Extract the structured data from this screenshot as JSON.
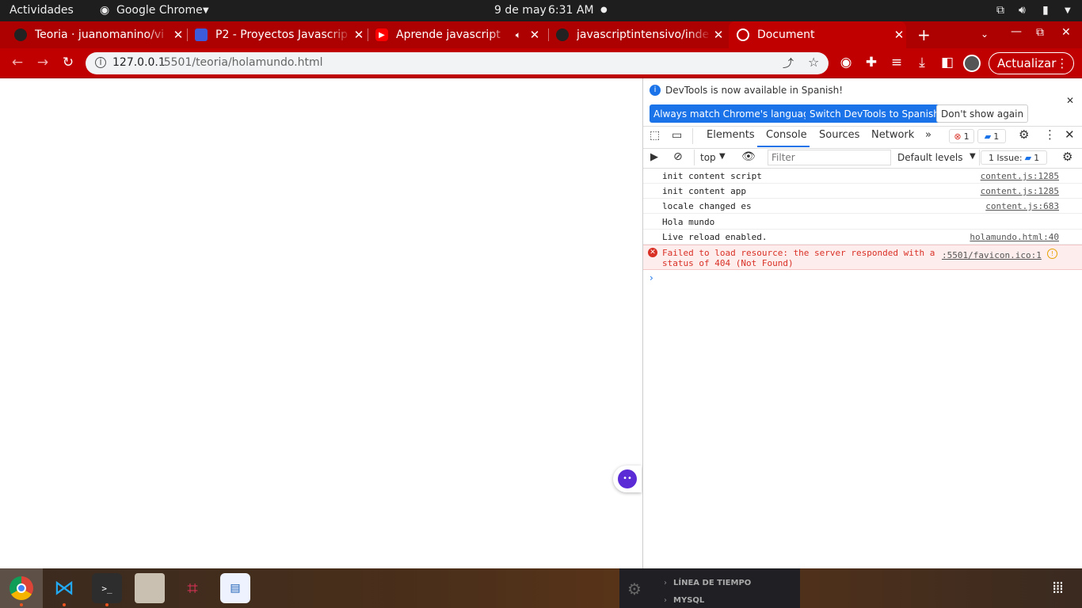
{
  "system_bar": {
    "activities": "Actividades",
    "app_name": "Google Chrome",
    "date": "9 de may",
    "time": "6:31 AM"
  },
  "tabs": [
    {
      "title": "Teoria · juanomanino/vi"
    },
    {
      "title": "P2 - Proyectos Javascrip"
    },
    {
      "title": "Aprende javascript"
    },
    {
      "title": "javascriptintensivo/inde"
    },
    {
      "title": "Document"
    }
  ],
  "address": {
    "host": "127.0.0.1",
    "path": ":5501/teoria/holamundo.html"
  },
  "update_button": "Actualizar",
  "devtools": {
    "banner": "DevTools is now available in Spanish!",
    "btn_match": "Always match Chrome's language",
    "btn_switch": "Switch DevTools to Spanish",
    "btn_dont": "Don't show again",
    "tabs": [
      "Elements",
      "Console",
      "Sources",
      "Network"
    ],
    "error_count": "1",
    "msg_count": "1",
    "context": "top",
    "filter_placeholder": "Filter",
    "levels": "Default levels",
    "issues_label": "1 Issue:",
    "issues_count": "1",
    "logs": [
      {
        "msg": "init content script",
        "src": "content.js:1285"
      },
      {
        "msg": "init content app",
        "src": "content.js:1285"
      },
      {
        "msg": "locale changed es",
        "src": "content.js:683"
      },
      {
        "msg": "Hola mundo",
        "src": ""
      },
      {
        "msg": "Live reload enabled.",
        "src": "holamundo.html:40"
      }
    ],
    "error": {
      "msg1": "Failed to load resource: the server responded with a",
      "msg2": "status of 404 (Not Found)",
      "src": ":5501/favicon.ico:1"
    }
  },
  "taskbar_panel": {
    "item1": "LÍNEA DE TIEMPO",
    "item2": "MYSQL"
  },
  "colors": {
    "chrome_red": "#ad0000",
    "accent_blue": "#1a73e8",
    "error_red": "#d93025"
  }
}
